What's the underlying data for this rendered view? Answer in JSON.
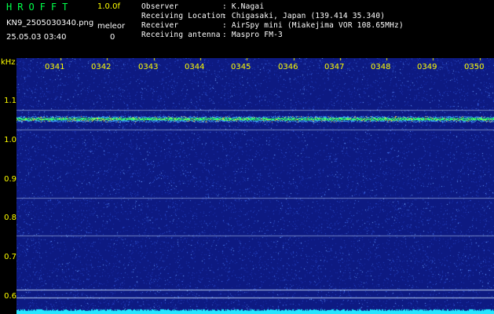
{
  "header": {
    "app_title": "HROFFT",
    "version": "1.0.0f",
    "filename": "KN9_2505030340.png",
    "datetime": "25.05.03 03:40",
    "meteor_label": "meleor",
    "meteor_count": "0",
    "info": [
      {
        "label": "Observer",
        "value": ": K.Nagai"
      },
      {
        "label": "Receiving Location",
        "value": ": Chigasaki, Japan (139.414 35.340)"
      },
      {
        "label": "Receiver",
        "value": ": AirSpy mini (Miakejima VOR 108.65MHz)"
      },
      {
        "label": "Receiving antenna",
        "value": ": Maspro FM-3"
      }
    ]
  },
  "spectrogram": {
    "y_unit": "kHz",
    "y_ticks": [
      "1.1",
      "1.0",
      "0.9",
      "0.8",
      "0.7",
      "0.6"
    ],
    "time_ticks": [
      "0341",
      "0342",
      "0343",
      "0344",
      "0345",
      "0346",
      "0347",
      "0348",
      "0349",
      "0350"
    ],
    "colors": {
      "background": "#0d1a82",
      "text": "#ffff00",
      "carrier": "#30ff70",
      "reference_line": "#cfe6ff",
      "noise_floor": "#26e6ff"
    }
  }
}
